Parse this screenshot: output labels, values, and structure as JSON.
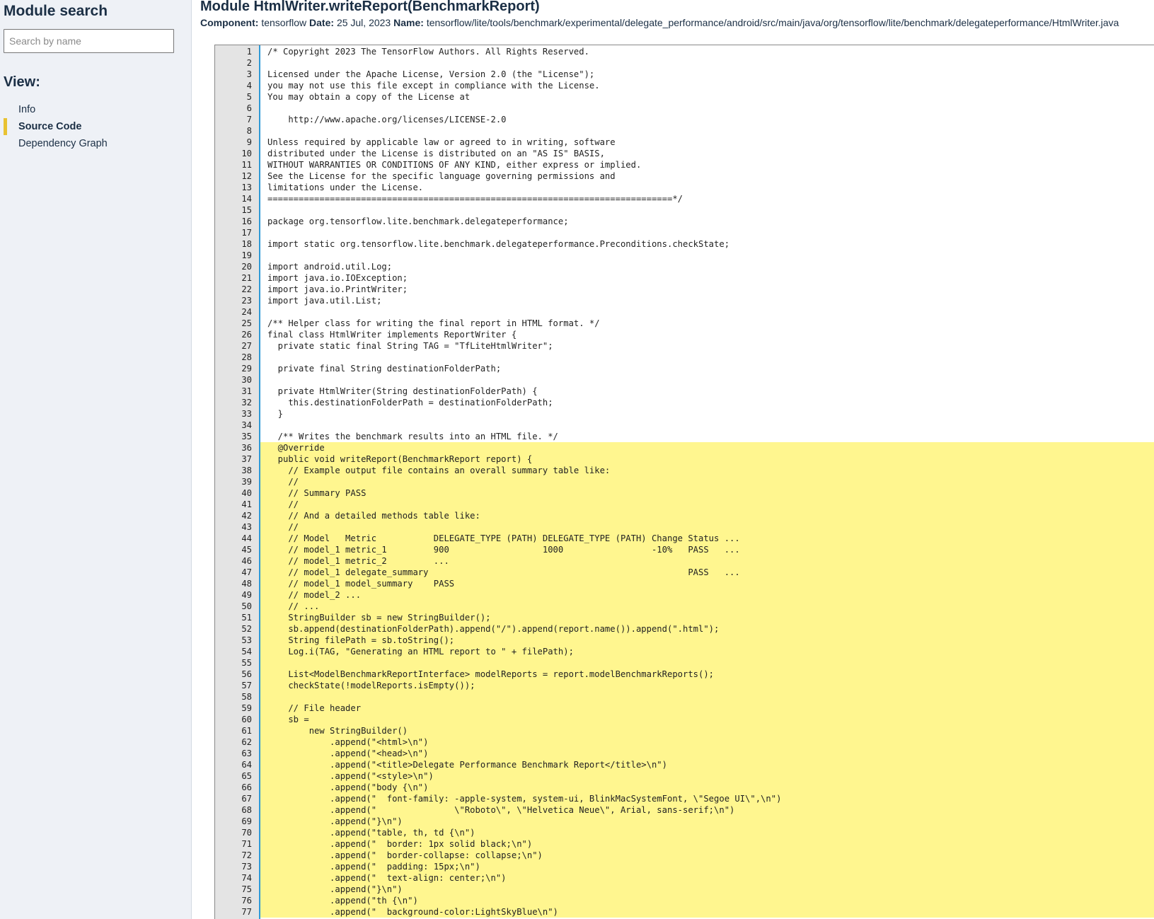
{
  "sidebar": {
    "title": "Module search",
    "search_placeholder": "Search by name",
    "view_heading": "View:",
    "items": [
      {
        "label": "Info",
        "active": false
      },
      {
        "label": "Source Code",
        "active": true
      },
      {
        "label": "Dependency Graph",
        "active": false
      }
    ]
  },
  "header": {
    "title": "Module HtmlWriter.writeReport(BenchmarkReport)",
    "component_label": "Component:",
    "component_value": "tensorflow",
    "date_label": "Date:",
    "date_value": "25 Jul, 2023",
    "name_label": "Name:",
    "name_value": "tensorflow/lite/tools/benchmark/experimental/delegate_performance/android/src/main/java/org/tensorflow/lite/benchmark/delegateperformance/HtmlWriter.java"
  },
  "colors": {
    "highlight": "#fff68f",
    "accent": "#e8c232",
    "gutter_border": "#2f9ad6"
  },
  "code": {
    "highlight_from": 36,
    "lines": [
      "/* Copyright 2023 The TensorFlow Authors. All Rights Reserved.",
      "",
      "Licensed under the Apache License, Version 2.0 (the \"License\");",
      "you may not use this file except in compliance with the License.",
      "You may obtain a copy of the License at",
      "",
      "    http://www.apache.org/licenses/LICENSE-2.0",
      "",
      "Unless required by applicable law or agreed to in writing, software",
      "distributed under the License is distributed on an \"AS IS\" BASIS,",
      "WITHOUT WARRANTIES OR CONDITIONS OF ANY KIND, either express or implied.",
      "See the License for the specific language governing permissions and",
      "limitations under the License.",
      "==============================================================================*/",
      "",
      "package org.tensorflow.lite.benchmark.delegateperformance;",
      "",
      "import static org.tensorflow.lite.benchmark.delegateperformance.Preconditions.checkState;",
      "",
      "import android.util.Log;",
      "import java.io.IOException;",
      "import java.io.PrintWriter;",
      "import java.util.List;",
      "",
      "/** Helper class for writing the final report in HTML format. */",
      "final class HtmlWriter implements ReportWriter {",
      "  private static final String TAG = \"TfLiteHtmlWriter\";",
      "",
      "  private final String destinationFolderPath;",
      "",
      "  private HtmlWriter(String destinationFolderPath) {",
      "    this.destinationFolderPath = destinationFolderPath;",
      "  }",
      "",
      "  /** Writes the benchmark results into an HTML file. */",
      "  @Override",
      "  public void writeReport(BenchmarkReport report) {",
      "    // Example output file contains an overall summary table like:",
      "    //",
      "    // Summary PASS",
      "    //",
      "    // And a detailed methods table like:",
      "    //",
      "    // Model   Metric           DELEGATE_TYPE (PATH) DELEGATE_TYPE (PATH) Change Status ...",
      "    // model_1 metric_1         900                  1000                 -10%   PASS   ...",
      "    // model_1 metric_2         ...",
      "    // model_1 delegate_summary                                                  PASS   ...",
      "    // model_1 model_summary    PASS",
      "    // model_2 ...",
      "    // ...",
      "    StringBuilder sb = new StringBuilder();",
      "    sb.append(destinationFolderPath).append(\"/\").append(report.name()).append(\".html\");",
      "    String filePath = sb.toString();",
      "    Log.i(TAG, \"Generating an HTML report to \" + filePath);",
      "",
      "    List<ModelBenchmarkReportInterface> modelReports = report.modelBenchmarkReports();",
      "    checkState(!modelReports.isEmpty());",
      "",
      "    // File header",
      "    sb =",
      "        new StringBuilder()",
      "            .append(\"<html>\\n\")",
      "            .append(\"<head>\\n\")",
      "            .append(\"<title>Delegate Performance Benchmark Report</title>\\n\")",
      "            .append(\"<style>\\n\")",
      "            .append(\"body {\\n\")",
      "            .append(\"  font-family: -apple-system, system-ui, BlinkMacSystemFont, \\\"Segoe UI\\\",\\n\")",
      "            .append(\"               \\\"Roboto\\\", \\\"Helvetica Neue\\\", Arial, sans-serif;\\n\")",
      "            .append(\"}\\n\")",
      "            .append(\"table, th, td {\\n\")",
      "            .append(\"  border: 1px solid black;\\n\")",
      "            .append(\"  border-collapse: collapse;\\n\")",
      "            .append(\"  padding: 15px;\\n\")",
      "            .append(\"  text-align: center;\\n\")",
      "            .append(\"}\\n\")",
      "            .append(\"th {\\n\")",
      "            .append(\"  background-color:LightSkyBlue\\n\")"
    ]
  }
}
